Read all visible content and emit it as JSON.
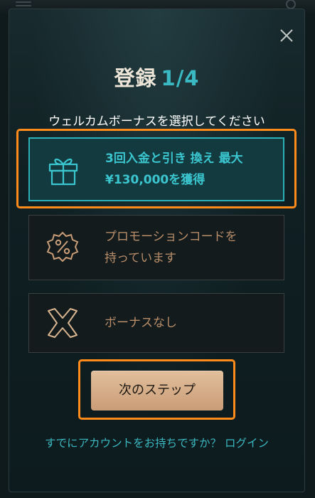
{
  "modal": {
    "title": "登録",
    "step": "1/4",
    "subtitle": "ウェルカムボーナスを選択してください"
  },
  "options": [
    {
      "line1": "3回入金と引き 換え 最大",
      "line2": "¥130,000を獲得",
      "icon": "gift-icon",
      "selected": true
    },
    {
      "line1": "プロモーションコードを",
      "line2": "持っています",
      "icon": "percent-badge-icon",
      "selected": false
    },
    {
      "line1": "ボーナスなし",
      "line2": "",
      "icon": "x-cross-icon",
      "selected": false
    }
  ],
  "next_button": "次のステップ",
  "login": {
    "prompt": "すでにアカウントをお持ちですか？",
    "link": "ログイン"
  },
  "colors": {
    "accent_teal": "#3bc6cf",
    "gold": "#b88d6a",
    "highlight": "#ff8c1a",
    "button": "#d7b08c"
  }
}
